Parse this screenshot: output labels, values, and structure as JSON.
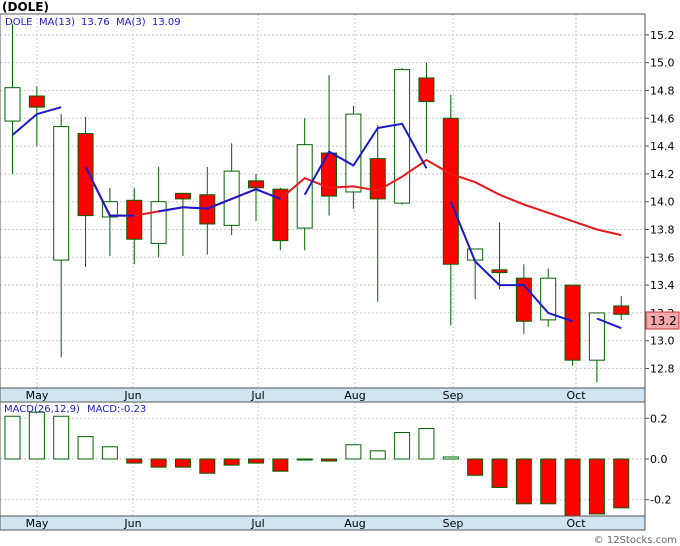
{
  "chart_data": [
    {
      "type": "candlestick",
      "title": "(DOLE)",
      "legend": {
        "symbol": "DOLE",
        "ma13_label": "MA(13)",
        "ma13_value": "13.76",
        "ma3_label": "MA(3)",
        "ma3_value": "13.09"
      },
      "x_labels": [
        "May",
        "Jun",
        "Jul",
        "Aug",
        "Sep",
        "Oct"
      ],
      "y_ticks": [
        "15.2",
        "15.0",
        "14.8",
        "14.6",
        "14.4",
        "14.2",
        "14.0",
        "13.8",
        "13.6",
        "13.4",
        "13.2",
        "13.0",
        "12.8"
      ],
      "ylim": [
        12.66,
        15.35
      ],
      "last_price": "13.2",
      "candles": [
        {
          "o": 14.58,
          "h": 15.28,
          "l": 14.2,
          "c": 14.82
        },
        {
          "o": 14.76,
          "h": 14.83,
          "l": 14.4,
          "c": 14.68
        },
        {
          "o": 13.58,
          "h": 14.63,
          "l": 12.88,
          "c": 14.54
        },
        {
          "o": 14.49,
          "h": 14.61,
          "l": 13.53,
          "c": 13.9
        },
        {
          "o": 13.89,
          "h": 14.1,
          "l": 13.61,
          "c": 14.0
        },
        {
          "o": 14.01,
          "h": 14.1,
          "l": 13.55,
          "c": 13.73
        },
        {
          "o": 13.7,
          "h": 14.25,
          "l": 13.6,
          "c": 14.0
        },
        {
          "o": 14.06,
          "h": 14.06,
          "l": 13.61,
          "c": 14.02
        },
        {
          "o": 14.05,
          "h": 14.25,
          "l": 13.62,
          "c": 13.84
        },
        {
          "o": 13.83,
          "h": 14.42,
          "l": 13.76,
          "c": 14.22
        },
        {
          "o": 14.15,
          "h": 14.2,
          "l": 13.86,
          "c": 14.1
        },
        {
          "o": 14.09,
          "h": 14.1,
          "l": 13.65,
          "c": 13.72
        },
        {
          "o": 13.81,
          "h": 14.6,
          "l": 13.65,
          "c": 14.41
        },
        {
          "o": 14.35,
          "h": 14.91,
          "l": 13.9,
          "c": 14.04
        },
        {
          "o": 14.07,
          "h": 14.69,
          "l": 13.95,
          "c": 14.63
        },
        {
          "o": 14.31,
          "h": 14.55,
          "l": 13.28,
          "c": 14.02
        },
        {
          "o": 13.99,
          "h": 14.96,
          "l": 13.98,
          "c": 14.95
        },
        {
          "o": 14.89,
          "h": 15.0,
          "l": 14.35,
          "c": 14.72
        },
        {
          "o": 14.6,
          "h": 14.77,
          "l": 13.11,
          "c": 13.55
        },
        {
          "o": 13.58,
          "h": 13.65,
          "l": 13.3,
          "c": 13.66
        },
        {
          "o": 13.51,
          "h": 13.85,
          "l": 13.37,
          "c": 13.49
        },
        {
          "o": 13.45,
          "h": 13.55,
          "l": 13.05,
          "c": 13.14
        },
        {
          "o": 13.15,
          "h": 13.52,
          "l": 13.1,
          "c": 13.45
        },
        {
          "o": 13.4,
          "h": 13.4,
          "l": 12.82,
          "c": 12.86
        },
        {
          "o": 12.86,
          "h": 13.2,
          "l": 12.7,
          "c": 13.2
        },
        {
          "o": 13.25,
          "h": 13.32,
          "l": 13.15,
          "c": 13.19
        }
      ],
      "ma13": [
        null,
        null,
        null,
        null,
        null,
        null,
        null,
        null,
        null,
        null,
        null,
        null,
        14.17,
        14.1,
        14.11,
        14.08,
        14.18,
        14.3,
        14.2,
        14.14,
        14.05,
        13.98,
        13.92,
        13.86,
        13.8,
        13.76
      ],
      "ma3": [
        14.48,
        14.63,
        14.68,
        14.25,
        13.9,
        13.9,
        13.93,
        13.96,
        13.95,
        14.02,
        14.09,
        14.02,
        14.05,
        14.36,
        14.26,
        14.53,
        14.56,
        14.24,
        14.0,
        13.57,
        13.4,
        13.4,
        13.2,
        13.14,
        13.16,
        13.09
      ],
      "ma3_breaks": [
        3,
        6,
        12,
        18,
        24
      ],
      "colors": {
        "up": "#ffffff",
        "down": "#ff0000",
        "ma13": "#e81919",
        "ma3": "#1a1acc",
        "border": "#006400"
      }
    },
    {
      "type": "bar",
      "title": "MACD(26,12,9)",
      "value_label": "MACD:-0.23",
      "x_labels": [
        "May",
        "Jun",
        "Jul",
        "Aug",
        "Sep",
        "Oct"
      ],
      "y_ticks": [
        "0.2",
        "0.0",
        "-0.2"
      ],
      "ylim": [
        -0.28,
        0.28
      ],
      "values": [
        0.21,
        0.23,
        0.21,
        0.11,
        0.06,
        -0.02,
        -0.04,
        -0.04,
        -0.07,
        -0.03,
        -0.02,
        -0.06,
        0.0,
        -0.01,
        0.07,
        0.04,
        0.13,
        0.15,
        0.01,
        -0.08,
        -0.14,
        -0.22,
        -0.22,
        -0.28,
        -0.27,
        -0.24
      ]
    }
  ]
}
